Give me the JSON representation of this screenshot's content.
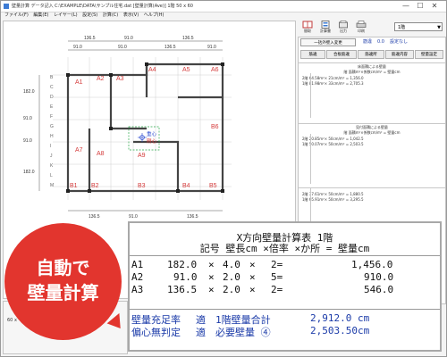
{
  "window": {
    "title": "壁量計算 データ記入 C:\\EXAMPLE\\DATA\\サンプル住宅.dat  [壁量計算(Ave)]  1階  50 x 60",
    "controls": {
      "minimize": "—",
      "maximize": "☐",
      "close": "✕"
    }
  },
  "menu": [
    "ファイル(F)",
    "編集(E)",
    "レイヤー(L)",
    "設定(S)",
    "計算(C)",
    "表示(V)",
    "ヘルプ(H)"
  ],
  "toolbar": {
    "buttons": [
      {
        "label": "間取",
        "icon": "floorplan-icon"
      },
      {
        "label": "計算書",
        "icon": "calc-report-icon"
      },
      {
        "label": "出力",
        "icon": "output-icon"
      },
      {
        "label": "印刷",
        "icon": "printer-icon"
      }
    ],
    "floor_selected": "1階"
  },
  "drawing": {
    "top_dims": [
      "136.5",
      "91.0",
      "136.5"
    ],
    "second_dims": [
      "91.0",
      "91.0",
      "136.5",
      "91.0"
    ],
    "bottom_dims": [
      "136.5",
      "91.0",
      "136.5"
    ],
    "left_dims": [
      "182.0",
      "91.0",
      "91.0",
      "182.0"
    ],
    "wall_labels_red": [
      "A1",
      "A2",
      "A3",
      "A4",
      "A5",
      "A6",
      "A7",
      "A8",
      "A9",
      "B1",
      "B2",
      "B3",
      "B4",
      "B5",
      "B6"
    ],
    "center_labels": [
      "重心",
      "剛心"
    ],
    "grid_letters": [
      "B",
      "C",
      "D",
      "E",
      "F",
      "G",
      "H",
      "I",
      "J",
      "K",
      "L",
      "M"
    ]
  },
  "right_panel": {
    "mode_button": "一括外壁入変更",
    "wall_label": "筋違",
    "wall_value": "0.0",
    "wall_unit": "設定なし",
    "tabs": [
      "筋違",
      "合板筋違",
      "筋違所",
      "筋違内容",
      "壁量設定"
    ],
    "box1": {
      "header": "床面積による壁量",
      "subheader": "階  面積m²×係数cm/m² = 壁量cm",
      "lines": [
        "2階  64.58m²×  21cm/m² = 1,356.0",
        "1階  81.98m²×  33cm/m² = 2,705.3"
      ]
    },
    "box2": {
      "header": "見付面積による壁量",
      "subheader": "階  面積m²×係数cm/m² = 壁量cm",
      "lines": [
        "2階  20.85m²×  50cm/m² = 1,042.5",
        "1階  50.07m²×  50cm/m² = 2,503.5"
      ]
    },
    "box3": {
      "lines": [
        "2階  37.61m²×  50cm/m² = 1,880.5",
        "1階  65.91m²×  50cm/m² = 3,295.5"
      ]
    }
  },
  "calc_table": {
    "title": "X方向壁量計算表  1階",
    "columns": "記号 壁長cm ×倍率 ×か所 = 壁量cm",
    "rows": [
      {
        "code": "A1",
        "length": "182.0",
        "x1": "×",
        "rate": "4.0",
        "x2": "×",
        "count": "2=",
        "result": "1,456.0"
      },
      {
        "code": "A2",
        "length": "91.0",
        "x1": "×",
        "rate": "2.0",
        "x2": "×",
        "count": "5=",
        "result": "910.0"
      },
      {
        "code": "A3",
        "length": "136.5",
        "x1": "×",
        "rate": "2.0",
        "x2": "×",
        "count": "2=",
        "result": "546.0"
      }
    ],
    "summary": [
      {
        "label": "壁量充足率",
        "status": "適",
        "item": "1階壁量合計",
        "value": "2,912.0 cm"
      },
      {
        "label": "偏心無判定",
        "status": "適",
        "item": "必要壁量   ④",
        "value": "2,503.50cm"
      }
    ]
  },
  "badge": {
    "line1": "自動で",
    "line2": "壁量計算"
  },
  "status": {
    "text": "60 x"
  },
  "colors": {
    "wall_red": "#d43a3a",
    "badge_red": "#e2352e",
    "summary_blue": "#1a3aa8",
    "center_blue": "#2a4ad0",
    "green_dash": "#2aa84a"
  }
}
